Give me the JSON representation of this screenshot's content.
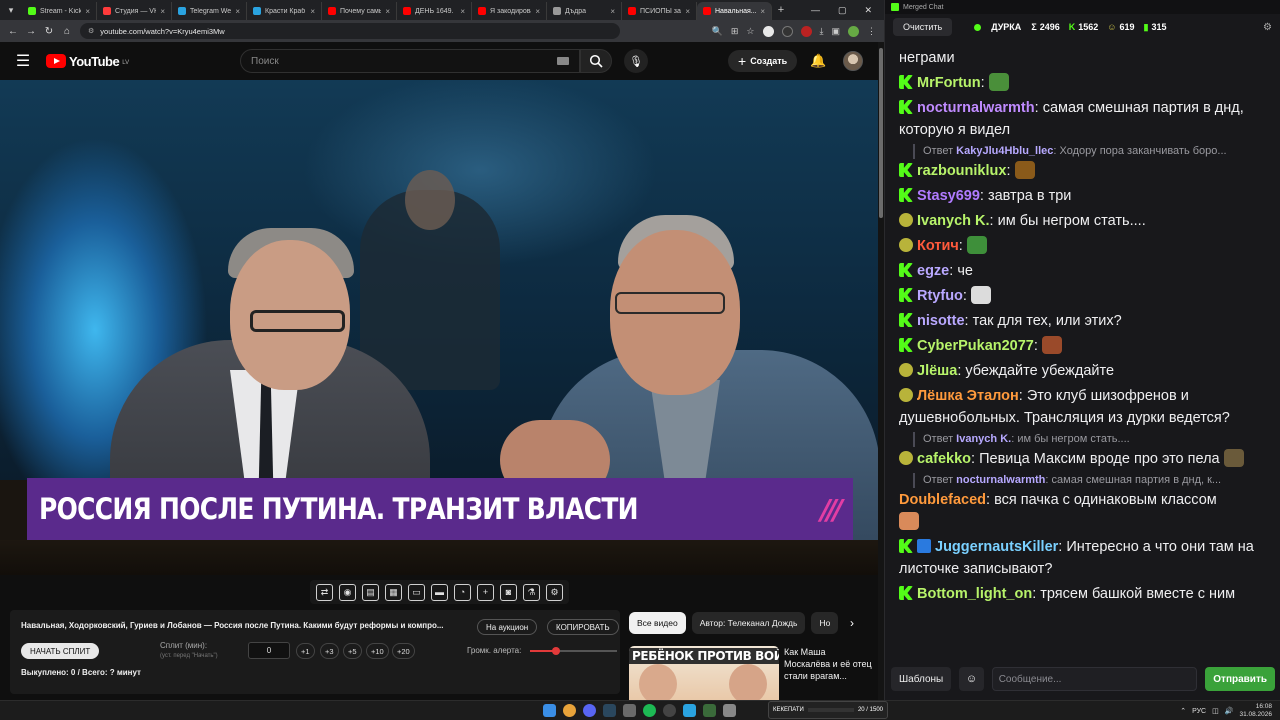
{
  "browser": {
    "tabs": [
      {
        "label": "Stream - Kick Studio",
        "fav": "#53fc18",
        "active": false
      },
      {
        "label": "Студия — VK Видео",
        "fav": "#ff3b3b",
        "active": false
      },
      {
        "label": "Telegram Web",
        "fav": "#2aa3e0",
        "active": false
      },
      {
        "label": "Красти Краб Бургеры",
        "fav": "#2aa3e0",
        "active": false
      },
      {
        "label": "Почему самые...",
        "fav": "#ff0000",
        "active": false
      },
      {
        "label": "ДЕНЬ 1649. ПУТ...",
        "fav": "#ff0000",
        "active": false
      },
      {
        "label": "Я закодировал...",
        "fav": "#ff0000",
        "active": false
      },
      {
        "label": "Дъдра",
        "fav": "#999999",
        "active": false
      },
      {
        "label": "ПСИОПЫ заш...",
        "fav": "#ff0000",
        "active": false
      },
      {
        "label": "Навальная...",
        "fav": "#ff0000",
        "active": true
      }
    ],
    "url": "youtube.com/watch?v=Kryu4emi3Mw"
  },
  "youtube": {
    "logo_text": "YouTube",
    "country": "LV",
    "search_placeholder": "Поиск",
    "create_label": "Создать"
  },
  "video": {
    "banner_text": "РОССИЯ ПОСЛЕ ПУТИНА. ТРАНЗИТ ВЛАСТИ",
    "banner_logo": "///"
  },
  "split_panel": {
    "title": "Навальная, Ходорковский, Гуриев и Лобанов — Россия после Путина. Какими будут реформы и компро...",
    "auction_label": "На аукцион",
    "copy_label": "КОПИРОВАТЬ",
    "start_label": "НАЧАТЬ СПЛИТ",
    "split_label": "Сплит (мин):",
    "split_hint": "(уст. перед \"Начать\")",
    "split_value": "0",
    "increments": [
      "+1",
      "+3",
      "+5",
      "+10",
      "+20"
    ],
    "volume_label": "Громк. алерта:",
    "volume_level": 0.3,
    "bought_text": "Выкуплено: 0 / Всего: ? минут"
  },
  "related": {
    "chips": [
      "Все видео",
      "Автор: Телеканал Дождь",
      "Но"
    ],
    "thumb_caption": "РЕБЁНОК ПРОТИВ ВОЙНЫ",
    "video_title": "Как Маша Москалёва и её отец стали врагам..."
  },
  "chat": {
    "window_title": "Merged Chat",
    "clear_label": "Очистить",
    "channel": "ДУРКА",
    "stats": [
      {
        "icon": "Σ",
        "value": "2496"
      },
      {
        "icon": "K",
        "value": "1562"
      },
      {
        "icon": "☺",
        "value": "619"
      },
      {
        "icon": "▮",
        "value": "315"
      }
    ],
    "messages": [
      {
        "type": "text",
        "badge": "",
        "user": "",
        "color": "#efeff1",
        "text": "неграми"
      },
      {
        "type": "msg",
        "badge": "kick",
        "user": "MrFortun",
        "color": "#b7f36a",
        "text": "",
        "emote": "#4a8f3a"
      },
      {
        "type": "msg",
        "badge": "kick",
        "user": "nocturnalwarmth",
        "color": "#c08bff",
        "text": "самая смешная партия в днд, которую я видел"
      },
      {
        "type": "reply",
        "ruser": "KakyJlu4Hblu_llec",
        "text": "Ходору пора заканчивать боро..."
      },
      {
        "type": "msg",
        "badge": "kick",
        "user": "razbouniklux",
        "color": "#b7f36a",
        "text": "",
        "emote": "#8a5a1a"
      },
      {
        "type": "msg",
        "badge": "kick",
        "user": "Stasy699",
        "color": "#b07bff",
        "text": "завтра в три"
      },
      {
        "type": "msg",
        "badge": "emo",
        "user": "Ivanych K.",
        "color": "#b7f36a",
        "text": "им бы негром стать...."
      },
      {
        "type": "msg",
        "badge": "emo",
        "user": "Котич",
        "color": "#ff5a3c",
        "text": "",
        "emote": "#3e8f3a"
      },
      {
        "type": "msg",
        "badge": "kick",
        "user": "egze",
        "color": "#b9a8ff",
        "text": "че"
      },
      {
        "type": "msg",
        "badge": "kick",
        "user": "Rtyfuo",
        "color": "#b9a8ff",
        "text": "",
        "emote": "#dcdcdc"
      },
      {
        "type": "msg",
        "badge": "kick",
        "user": "nisotte",
        "color": "#b9a8ff",
        "text": "так для тех, или этих?"
      },
      {
        "type": "msg",
        "badge": "kick",
        "user": "CyberPukan2077",
        "color": "#b7f36a",
        "text": "",
        "emote": "#9a4a2a"
      },
      {
        "type": "msg",
        "badge": "emo",
        "user": "Jlёша",
        "color": "#b7f36a",
        "text": "убеждайте убеждайте"
      },
      {
        "type": "msg",
        "badge": "emo",
        "user": "Лёшка Эталон",
        "color": "#ff9a3c",
        "text": "Это клуб шизофренов и душевнобольных. Трансляция из дурки ведется?"
      },
      {
        "type": "reply",
        "ruser": "Ivanych K.",
        "text": "им бы негром стать...."
      },
      {
        "type": "msg",
        "badge": "emo",
        "user": "cafekko",
        "color": "#b7f36a",
        "text": "Певица Максим вроде про это пела",
        "emote_after": "#6a5a3a"
      },
      {
        "type": "reply",
        "ruser": "nocturnalwarmth",
        "text": "самая смешная партия в днд, к..."
      },
      {
        "type": "msg",
        "badge": "",
        "user": "Doublefaced",
        "color": "#ff9a3c",
        "text": "вся пачка с одинаковым классом",
        "emote_below": "#d98a5a"
      },
      {
        "type": "msg",
        "badge": "kick",
        "user": "JuggernautsKiller",
        "color": "#7ad0ff",
        "text": "Интересно а что они там на листочке записывают?",
        "extra_badge": "#2a7adf"
      },
      {
        "type": "msg",
        "badge": "kick",
        "user": "Bottom_light_on",
        "color": "#b7f36a",
        "text": "трясем башкой вместе с ним"
      }
    ],
    "templates_label": "Шаблоны",
    "input_placeholder": "Сообщение...",
    "send_label": "Отправить"
  },
  "taskbar": {
    "overlay_label": "КЕКЕПАТИ",
    "overlay_value": "20 / 1500",
    "lang": "РУС",
    "time": "16:08",
    "date": "31.08.2026"
  }
}
